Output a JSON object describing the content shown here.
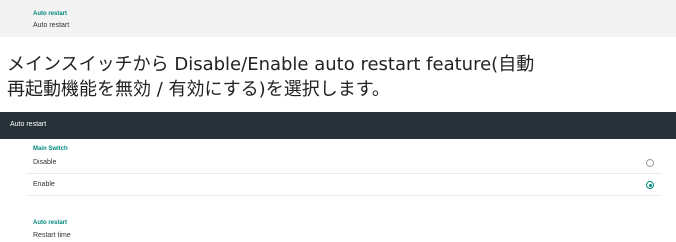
{
  "top_panel": {
    "section_label": "Auto restart",
    "item_label": "Auto restart"
  },
  "description": {
    "line1": "メインスイッチから Disable/Enable auto restart feature(自動",
    "line2": "再起動機能を無効 / 有効にする)を選択します。"
  },
  "dialog": {
    "title": "Auto restart",
    "main_switch_label": "Main Switch",
    "options": [
      {
        "label": "Disable",
        "selected": false
      },
      {
        "label": "Enable",
        "selected": true
      }
    ],
    "auto_restart_label": "Auto restart",
    "restart_time_label": "Restart time"
  },
  "colors": {
    "accent": "#00897b",
    "titlebar": "#263238"
  }
}
